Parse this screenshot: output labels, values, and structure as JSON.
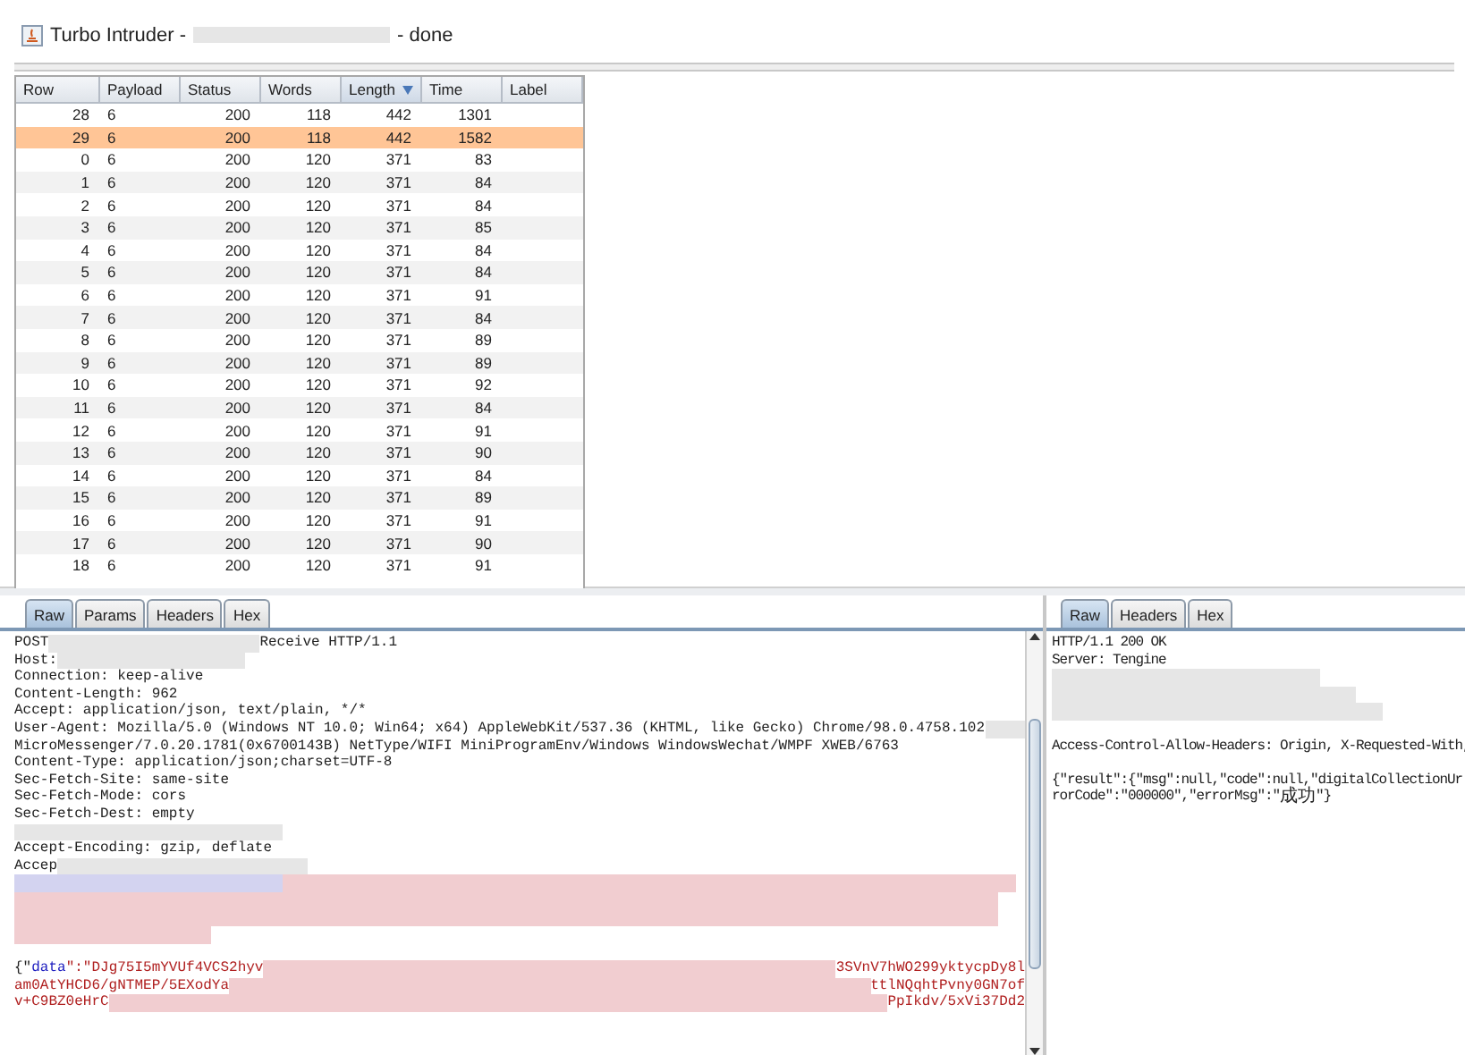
{
  "window": {
    "title": [
      {
        "kind": "text",
        "text": "Turbo Intruder -"
      },
      {
        "kind": "blur"
      },
      {
        "kind": "text",
        "text": "- done"
      }
    ]
  },
  "table": {
    "columns": [
      {
        "label": "Row",
        "sorted": false
      },
      {
        "label": "Payload",
        "sorted": false
      },
      {
        "label": "Status",
        "sorted": false
      },
      {
        "label": "Words",
        "sorted": false
      },
      {
        "label": "Length",
        "sorted": true
      },
      {
        "label": "Time",
        "sorted": false
      },
      {
        "label": "Label",
        "sorted": false
      }
    ],
    "rows": [
      {
        "cells": [
          "28",
          "6",
          "200",
          "118",
          "442",
          "1301",
          ""
        ],
        "selected": false
      },
      {
        "cells": [
          "29",
          "6",
          "200",
          "118",
          "442",
          "1582",
          ""
        ],
        "selected": true
      },
      {
        "cells": [
          "0",
          "6",
          "200",
          "120",
          "371",
          "83",
          ""
        ],
        "selected": false
      },
      {
        "cells": [
          "1",
          "6",
          "200",
          "120",
          "371",
          "84",
          ""
        ],
        "selected": false
      },
      {
        "cells": [
          "2",
          "6",
          "200",
          "120",
          "371",
          "84",
          ""
        ],
        "selected": false
      },
      {
        "cells": [
          "3",
          "6",
          "200",
          "120",
          "371",
          "85",
          ""
        ],
        "selected": false
      },
      {
        "cells": [
          "4",
          "6",
          "200",
          "120",
          "371",
          "84",
          ""
        ],
        "selected": false
      },
      {
        "cells": [
          "5",
          "6",
          "200",
          "120",
          "371",
          "84",
          ""
        ],
        "selected": false
      },
      {
        "cells": [
          "6",
          "6",
          "200",
          "120",
          "371",
          "91",
          ""
        ],
        "selected": false
      },
      {
        "cells": [
          "7",
          "6",
          "200",
          "120",
          "371",
          "84",
          ""
        ],
        "selected": false
      },
      {
        "cells": [
          "8",
          "6",
          "200",
          "120",
          "371",
          "89",
          ""
        ],
        "selected": false
      },
      {
        "cells": [
          "9",
          "6",
          "200",
          "120",
          "371",
          "89",
          ""
        ],
        "selected": false
      },
      {
        "cells": [
          "10",
          "6",
          "200",
          "120",
          "371",
          "92",
          ""
        ],
        "selected": false
      },
      {
        "cells": [
          "11",
          "6",
          "200",
          "120",
          "371",
          "84",
          ""
        ],
        "selected": false
      },
      {
        "cells": [
          "12",
          "6",
          "200",
          "120",
          "371",
          "91",
          ""
        ],
        "selected": false
      },
      {
        "cells": [
          "13",
          "6",
          "200",
          "120",
          "371",
          "90",
          ""
        ],
        "selected": false
      },
      {
        "cells": [
          "14",
          "6",
          "200",
          "120",
          "371",
          "84",
          ""
        ],
        "selected": false
      },
      {
        "cells": [
          "15",
          "6",
          "200",
          "120",
          "371",
          "89",
          ""
        ],
        "selected": false
      },
      {
        "cells": [
          "16",
          "6",
          "200",
          "120",
          "371",
          "91",
          ""
        ],
        "selected": false
      },
      {
        "cells": [
          "17",
          "6",
          "200",
          "120",
          "371",
          "90",
          ""
        ],
        "selected": false
      },
      {
        "cells": [
          "18",
          "6",
          "200",
          "120",
          "371",
          "91",
          ""
        ],
        "selected": false
      }
    ]
  },
  "request": {
    "tabs": [
      {
        "label": "Raw",
        "selected": true
      },
      {
        "label": "Params",
        "selected": false
      },
      {
        "label": "Headers",
        "selected": false
      },
      {
        "label": "Hex",
        "selected": false
      }
    ],
    "lines": [
      [
        {
          "kind": "text",
          "text": "POST"
        },
        {
          "kind": "blur"
        },
        {
          "kind": "text",
          "text": "Receive HTTP/1.1"
        }
      ],
      [
        {
          "kind": "text",
          "text": "Host:"
        },
        {
          "kind": "blur"
        }
      ],
      [
        {
          "kind": "text",
          "text": "Connection: keep-alive"
        }
      ],
      [
        {
          "kind": "text",
          "text": "Content-Length: 962"
        }
      ],
      [
        {
          "kind": "text",
          "text": "Accept: application/json, text/plain, */*"
        }
      ],
      [
        {
          "kind": "text",
          "text": "User-Agent: Mozilla/5.0 (Windows NT 10.0; Win64; x64) AppleWebKit/537.36 (KHTML, like Gecko) Chrome/98.0.4758.102"
        },
        {
          "kind": "blur"
        }
      ],
      [
        {
          "kind": "text",
          "text": "MicroMessenger/7.0.20.1781(0x6700143B) NetType/WIFI MiniProgramEnv/Windows WindowsWechat/WMPF XWEB/6763"
        }
      ],
      [
        {
          "kind": "text",
          "text": "Content-Type: application/json;charset=UTF-8"
        }
      ],
      [
        {
          "kind": "text",
          "text": "Sec-Fetch-Site: same-site"
        }
      ],
      [
        {
          "kind": "text",
          "text": "Sec-Fetch-Mode: cors"
        }
      ],
      [
        {
          "kind": "text",
          "text": "Sec-Fetch-Dest: empty"
        }
      ],
      [
        {
          "kind": "blur"
        }
      ],
      [
        {
          "kind": "text",
          "text": "Accept-Encoding: gzip, deflate"
        }
      ],
      [
        {
          "kind": "text",
          "text": "Accep"
        },
        {
          "kind": "blur"
        }
      ],
      [
        {
          "kind": "blur"
        },
        {
          "kind": "blur"
        }
      ],
      [
        {
          "kind": "blur"
        }
      ],
      [
        {
          "kind": "blur"
        }
      ],
      [
        {
          "kind": "blur"
        }
      ],
      [
        {
          "kind": "punct",
          "text": "{\""
        },
        {
          "kind": "key",
          "text": "data"
        },
        {
          "kind": "string",
          "text": "\":\"DJg75I5mYVUf4VCS2hyv"
        },
        {
          "kind": "blur"
        },
        {
          "kind": "string",
          "text": "3SVnV7hWO299yktycpDy8l"
        }
      ],
      [
        {
          "kind": "string",
          "text": "am0AtYHCD6/gNTMEP/5EXodYa"
        },
        {
          "kind": "blur"
        },
        {
          "kind": "string",
          "text": "ttlNQqhtPvny0GN7of"
        }
      ],
      [
        {
          "kind": "string",
          "text": "v+C9BZ0eHrC"
        },
        {
          "kind": "blur"
        },
        {
          "kind": "string",
          "text": "PpIkdv/5xVi37Dd2"
        }
      ]
    ]
  },
  "response": {
    "tabs": [
      {
        "label": "Raw",
        "selected": true
      },
      {
        "label": "Headers",
        "selected": false
      },
      {
        "label": "Hex",
        "selected": false
      }
    ],
    "lines": [
      [
        {
          "kind": "text",
          "text": "HTTP/1.1 200 OK"
        }
      ],
      [
        {
          "kind": "text",
          "text": "Server: Tengine"
        }
      ],
      [
        {
          "kind": "blur"
        }
      ],
      [
        {
          "kind": "blur"
        }
      ],
      [
        {
          "kind": "blur"
        }
      ],
      [
        {
          "kind": "text",
          "text": "Access-Control-Allow-Headers: Origin, X-Requested-With,"
        }
      ],
      [
        {
          "kind": "text",
          "text": "{\"result\":{\"msg\":null,\"code\":null,\"digitalCollectionUr"
        }
      ],
      [
        {
          "kind": "text",
          "text": "rorCode\":\"000000\",\"errorMsg\":\""
        },
        {
          "kind": "cjk",
          "text": "成功"
        },
        {
          "kind": "text",
          "text": "\"}"
        }
      ]
    ]
  }
}
